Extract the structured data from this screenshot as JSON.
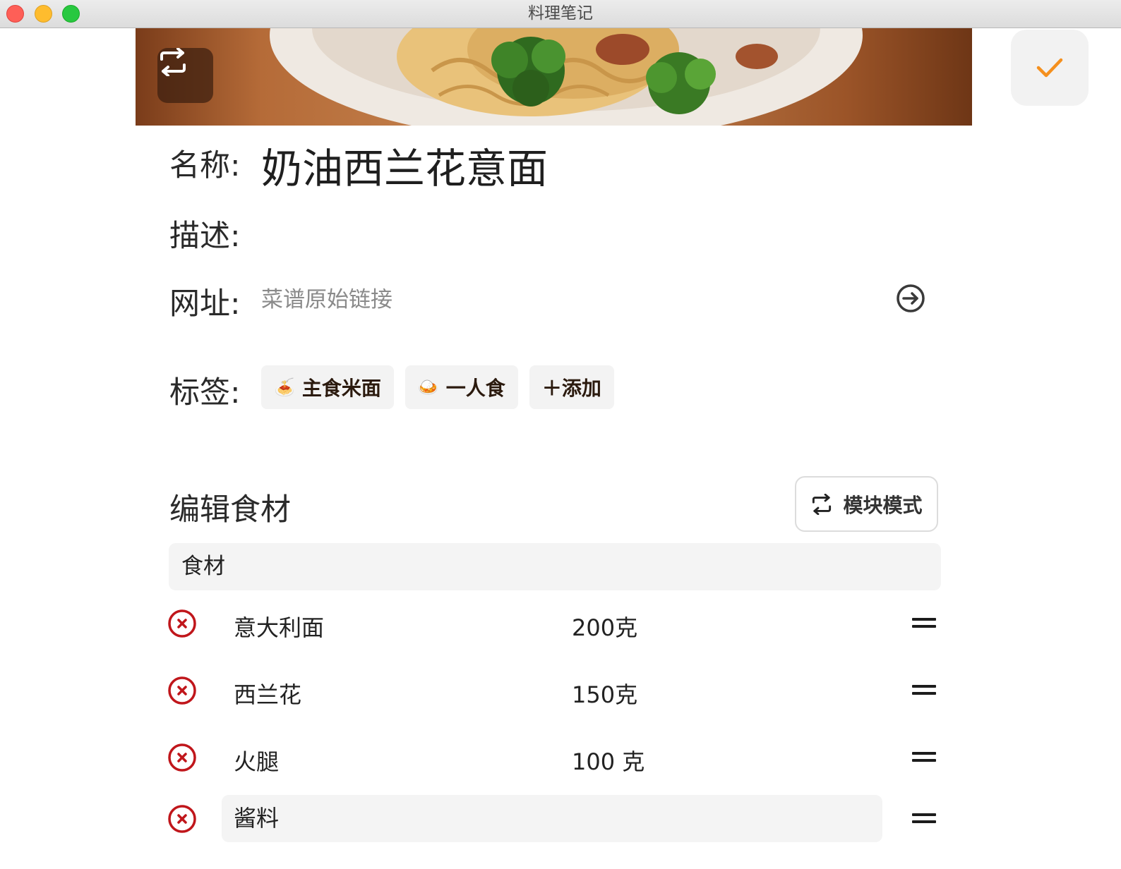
{
  "window": {
    "title": "料理笔记"
  },
  "hero": {
    "swap_icon": "swap-arrows-icon"
  },
  "toolbar": {
    "confirm_icon": "checkmark-icon",
    "accent_color": "#f5901e"
  },
  "form": {
    "name_label": "名称:",
    "name_value": "奶油西兰花意面",
    "description_label": "描述:",
    "url_label": "网址:",
    "url_placeholder": "菜谱原始链接",
    "tags_label": "标签:"
  },
  "tags": [
    {
      "emoji": "🍝",
      "label": "主食米面"
    },
    {
      "emoji": "🍛",
      "label": "一人食"
    },
    {
      "emoji": "",
      "label": "＋添加"
    }
  ],
  "ingredients": {
    "title": "编辑食材",
    "mode_button_label": "模块模式",
    "group_label": "食材",
    "items": [
      {
        "name": "意大利面",
        "qty": "200克"
      },
      {
        "name": "西兰花",
        "qty": "150克"
      },
      {
        "name": "火腿",
        "qty": "100 克"
      }
    ],
    "subgroup_label": "酱料",
    "remove_color": "#c0161b"
  }
}
